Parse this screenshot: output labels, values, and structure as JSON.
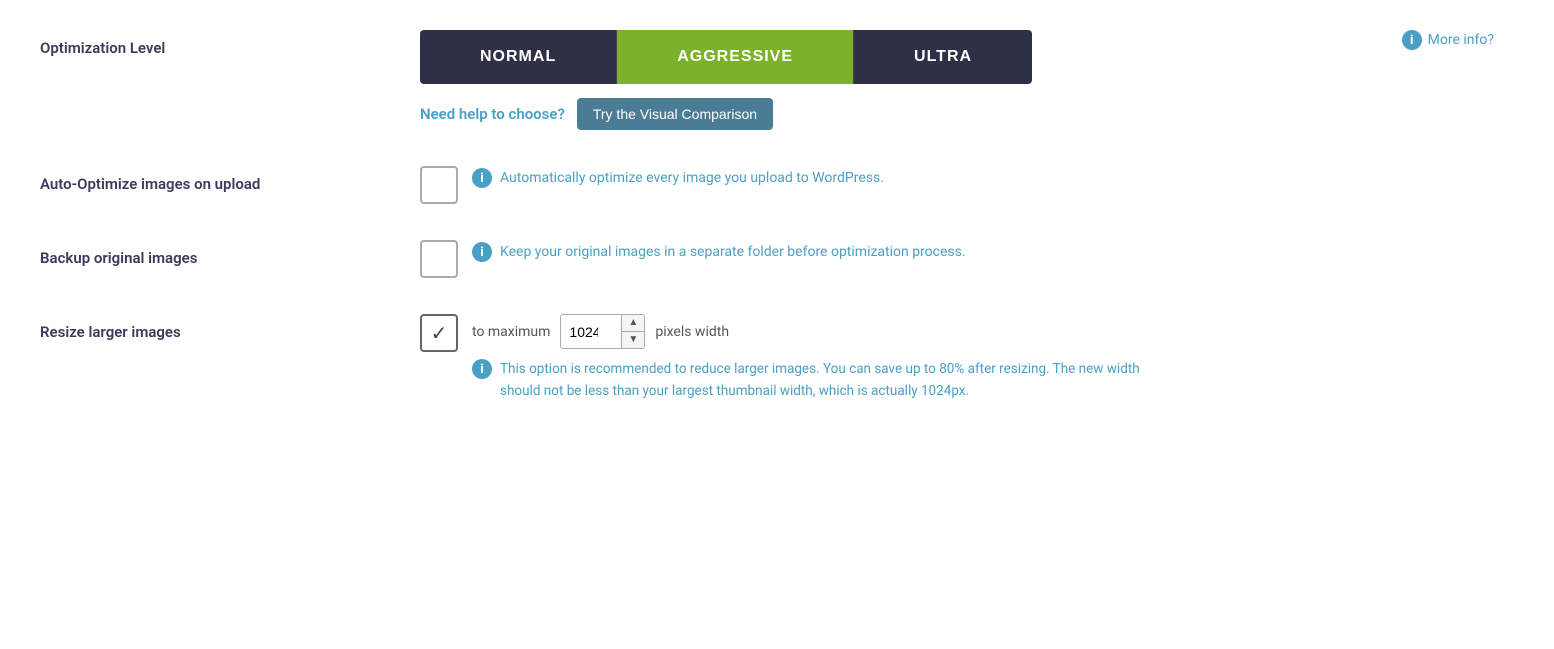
{
  "optimization_level": {
    "label": "Optimization Level",
    "buttons": [
      {
        "id": "normal",
        "label": "NORMAL",
        "active": false
      },
      {
        "id": "aggressive",
        "label": "AGGRESSIVE",
        "active": true
      },
      {
        "id": "ultra",
        "label": "ULTRA",
        "active": false
      }
    ],
    "more_info_label": "More info?",
    "need_help_text": "Need help to choose?",
    "visual_comparison_btn": "Try the Visual Comparison"
  },
  "auto_optimize": {
    "label": "Auto-Optimize images on upload",
    "checked": false,
    "description": "Automatically optimize every image you upload to WordPress."
  },
  "backup_original": {
    "label": "Backup original images",
    "checked": false,
    "description": "Keep your original images in a separate folder before optimization process."
  },
  "resize_larger": {
    "label": "Resize larger images",
    "checked": true,
    "prefix_text": "to maximum",
    "value": "1024",
    "suffix_text": "pixels width",
    "note": "This option is recommended to reduce larger images. You can save up to 80% after resizing. The new width should not be less than your largest thumbnail width, which is actually 1024px."
  },
  "icons": {
    "info": "ℹ",
    "check": "✓"
  }
}
